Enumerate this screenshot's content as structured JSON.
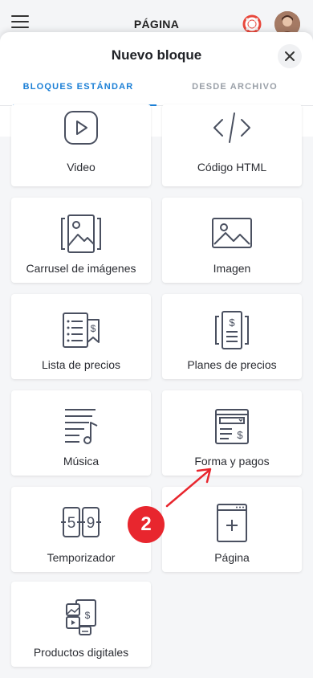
{
  "topbar": {
    "title": "PÁGINA",
    "menu_icon": "hamburger-menu-icon",
    "help_icon": "lifebuoy-icon",
    "avatar_icon": "user-avatar"
  },
  "sheet": {
    "title": "Nuevo bloque",
    "close_icon": "close-icon",
    "tabs": [
      {
        "label": "BLOQUES ESTÁNDAR",
        "active": true
      },
      {
        "label": "DESDE ARCHIVO",
        "active": false
      }
    ]
  },
  "blocks": [
    {
      "label": "Video",
      "icon": "video-play-icon"
    },
    {
      "label": "Código HTML",
      "icon": "code-icon"
    },
    {
      "label": "Carrusel de imágenes",
      "icon": "image-carousel-icon"
    },
    {
      "label": "Imagen",
      "icon": "image-icon"
    },
    {
      "label": "Lista de precios",
      "icon": "price-list-icon"
    },
    {
      "label": "Planes de precios",
      "icon": "pricing-plans-icon"
    },
    {
      "label": "Música",
      "icon": "music-icon"
    },
    {
      "label": "Forma y pagos",
      "icon": "form-payment-icon"
    },
    {
      "label": "Temporizador",
      "icon": "timer-icon"
    },
    {
      "label": "Página",
      "icon": "page-add-icon"
    },
    {
      "label": "Productos digitales",
      "icon": "digital-products-icon"
    }
  ],
  "annotation": {
    "badge": "2",
    "colors": {
      "badge": "#e8262e",
      "accent": "#1b7fd6"
    }
  }
}
